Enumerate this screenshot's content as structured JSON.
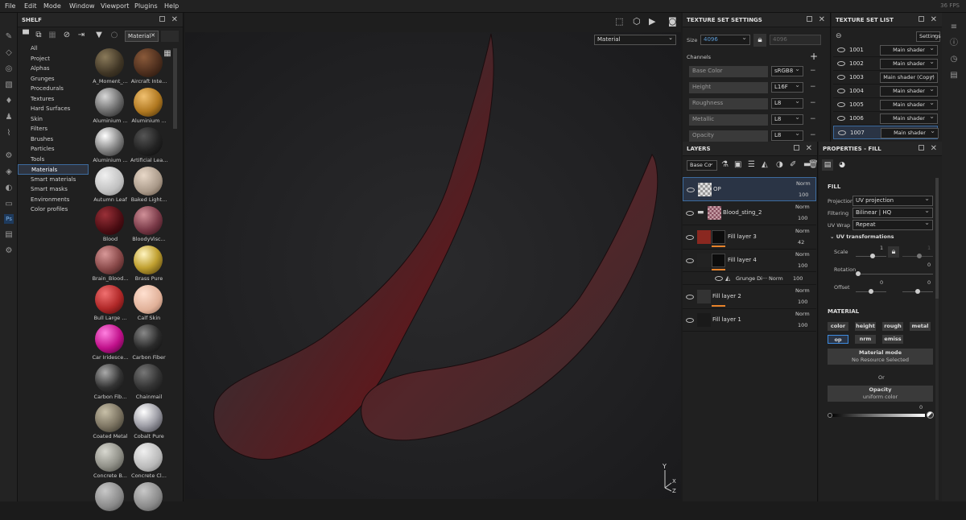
{
  "menubar": {
    "items": [
      "File",
      "Edit",
      "Mode",
      "Window",
      "Viewport",
      "Plugins",
      "Help"
    ],
    "fps": "36 FPS"
  },
  "shelf": {
    "title": "SHELF",
    "filter_text": "Material",
    "categories": [
      "All",
      "Project",
      "Alphas",
      "Grunges",
      "Procedurals",
      "Textures",
      "Hard Surfaces",
      "Skin",
      "Filters",
      "Brushes",
      "Particles",
      "Tools",
      "Materials",
      "Smart materials",
      "Smart masks",
      "Environments",
      "Color profiles"
    ],
    "selected_category": "Materials",
    "materials": [
      "A_Moment_...",
      "Aircraft Inte...",
      "Aluminium ...",
      "Aluminium ...",
      "Aluminium ...",
      "Artificial Lea...",
      "Autumn Leaf",
      "Baked Light...",
      "Blood",
      "BloodyVisc...",
      "Brain_Blood...",
      "Brass Pure",
      "Bull Large ...",
      "Calf Skin",
      "Car Iridesce...",
      "Carbon Fiber",
      "Carbon Fib...",
      "Chainmail",
      "Coated Metal",
      "Cobalt Pure",
      "Concrete B...",
      "Concrete Cl...",
      "",
      ""
    ]
  },
  "viewport": {
    "display_mode": "Material",
    "axis_y": "Y",
    "axis_x": "X",
    "axis_z": "Z"
  },
  "texture_set_settings": {
    "title": "TEXTURE SET SETTINGS",
    "size_label": "Size",
    "size_value": "4096",
    "size_value2": "4096",
    "channels_label": "Channels",
    "channels": [
      {
        "name": "Base Color",
        "format": "sRGB8"
      },
      {
        "name": "Height",
        "format": "L16F"
      },
      {
        "name": "Roughness",
        "format": "L8"
      },
      {
        "name": "Metallic",
        "format": "L8"
      },
      {
        "name": "Opacity",
        "format": "L8"
      }
    ]
  },
  "texture_set_list": {
    "title": "TEXTURE SET LIST",
    "settings_label": "Settings",
    "sets": [
      {
        "id": "1001",
        "shader": "Main shader"
      },
      {
        "id": "1002",
        "shader": "Main shader"
      },
      {
        "id": "1003",
        "shader": "Main shader (Copy)"
      },
      {
        "id": "1004",
        "shader": "Main shader"
      },
      {
        "id": "1005",
        "shader": "Main shader"
      },
      {
        "id": "1006",
        "shader": "Main shader"
      },
      {
        "id": "1007",
        "shader": "Main shader"
      }
    ],
    "selected": "1007"
  },
  "layers": {
    "title": "LAYERS",
    "channel_select": "Base Co",
    "rows": [
      {
        "name": "OP",
        "blend": "Norm",
        "opacity": "100"
      },
      {
        "name": "Blood_sting_2",
        "blend": "Norm",
        "opacity": "100"
      },
      {
        "name": "Fill layer 3",
        "blend": "Norm",
        "opacity": "42"
      },
      {
        "name": "Fill layer 4",
        "blend": "Norm",
        "opacity": "100"
      },
      {
        "name": "Grunge Di···",
        "blend": "Norm",
        "opacity": "100"
      },
      {
        "name": "Fill layer 2",
        "blend": "Norm",
        "opacity": "100"
      },
      {
        "name": "Fill layer 1",
        "blend": "Norm",
        "opacity": "100"
      }
    ]
  },
  "properties": {
    "title": "PROPERTIES - FILL",
    "fill_label": "FILL",
    "projection_label": "Projection",
    "projection_value": "UV projection",
    "filtering_label": "Filtering",
    "filtering_value": "Bilinear | HQ",
    "uvwrap_label": "UV Wrap",
    "uvwrap_value": "Repeat",
    "uvtrans_label": "UV transformations",
    "scale_label": "Scale",
    "scale_value": "1",
    "scale_value2": "1",
    "rotation_label": "Rotation",
    "rotation_value": "0",
    "offset_label": "Offset",
    "offset_value": "0",
    "offset_value2": "0",
    "material_label": "MATERIAL",
    "channel_buttons": [
      "color",
      "height",
      "rough",
      "metal",
      "op",
      "nrm",
      "emiss"
    ],
    "material_mode_label": "Material mode",
    "material_mode_value": "No Resource Selected",
    "or_label": "Or",
    "opacity_label": "Opacity",
    "opacity_sub": "uniform color",
    "opacity_value": "0"
  }
}
